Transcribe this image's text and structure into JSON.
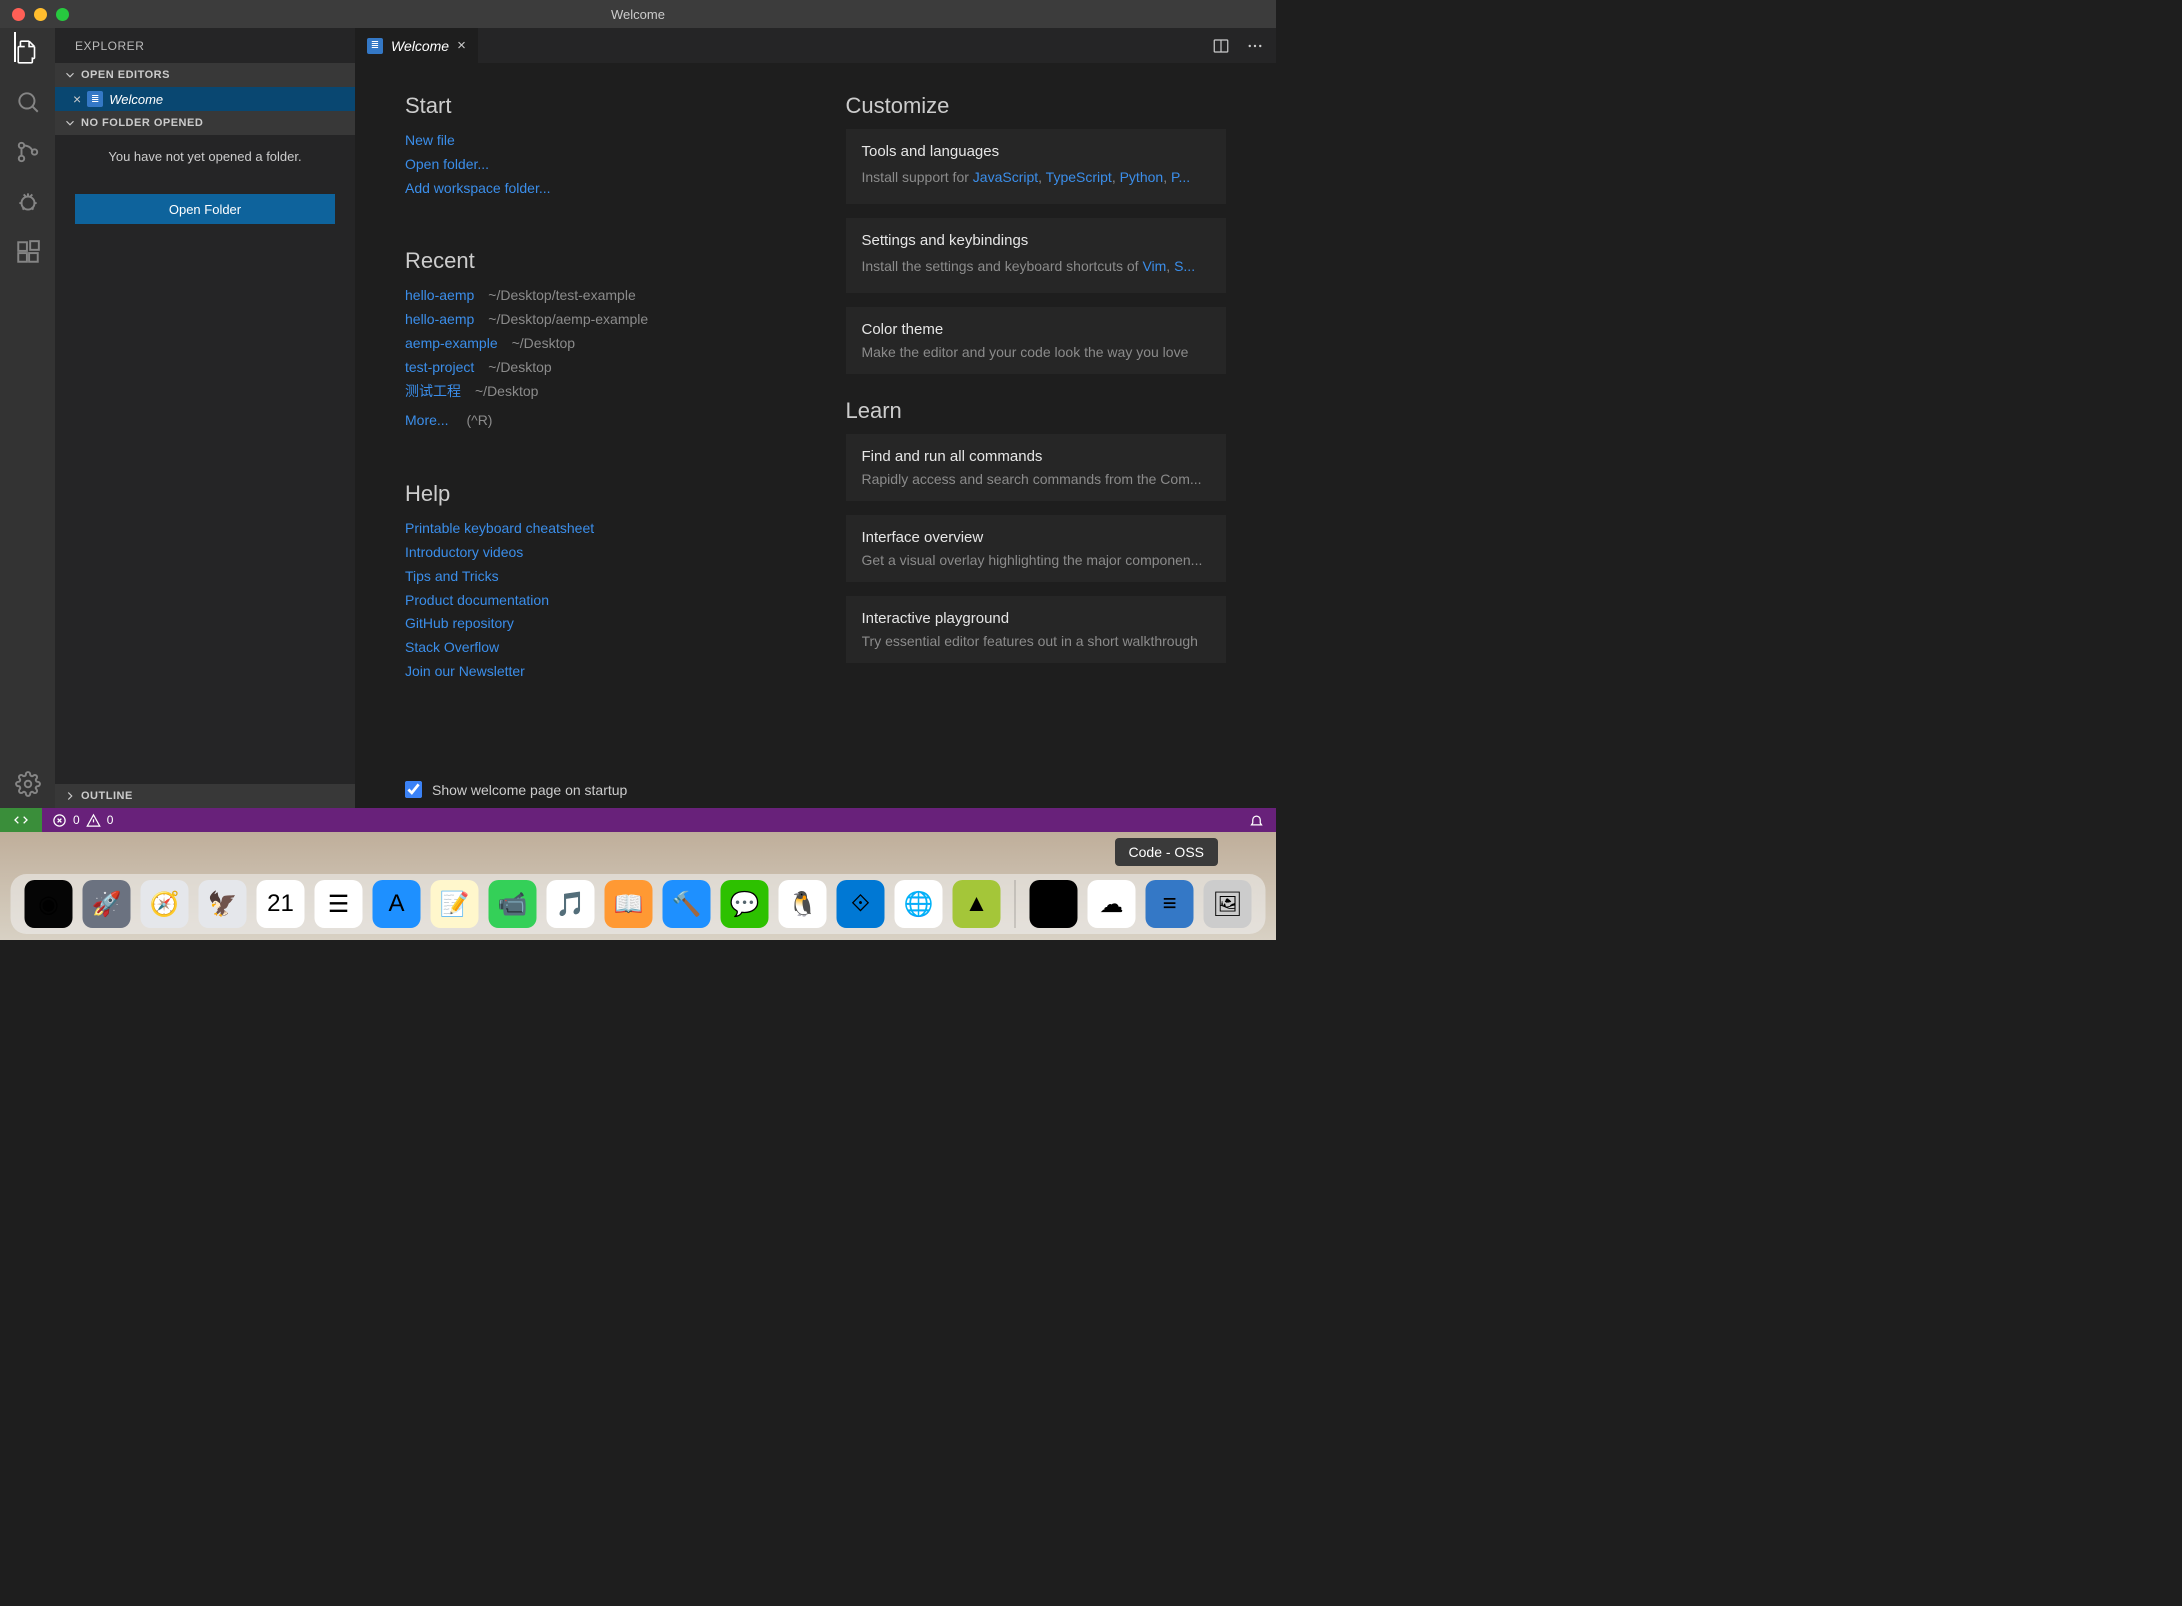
{
  "window": {
    "title": "Welcome"
  },
  "activityBar": {
    "items": [
      "files",
      "search",
      "source-control",
      "debug",
      "extensions"
    ],
    "bottom": [
      "settings"
    ]
  },
  "sidebar": {
    "title": "EXPLORER",
    "sections": {
      "openEditors": "OPEN EDITORS",
      "noFolder": "NO FOLDER OPENED",
      "outline": "OUTLINE"
    },
    "openEditorItem": "Welcome",
    "noFolderMsg": "You have not yet opened a folder.",
    "openFolderBtn": "Open Folder"
  },
  "tab": {
    "label": "Welcome"
  },
  "start": {
    "heading": "Start",
    "links": [
      "New file",
      "Open folder...",
      "Add workspace folder..."
    ]
  },
  "recent": {
    "heading": "Recent",
    "items": [
      {
        "name": "hello-aemp",
        "path": "~/Desktop/test-example"
      },
      {
        "name": "hello-aemp",
        "path": "~/Desktop/aemp-example"
      },
      {
        "name": "aemp-example",
        "path": "~/Desktop"
      },
      {
        "name": "test-project",
        "path": "~/Desktop"
      },
      {
        "name": "测试工程",
        "path": "~/Desktop"
      }
    ],
    "more": "More...",
    "moreHint": "(^R)"
  },
  "help": {
    "heading": "Help",
    "links": [
      "Printable keyboard cheatsheet",
      "Introductory videos",
      "Tips and Tricks",
      "Product documentation",
      "GitHub repository",
      "Stack Overflow",
      "Join our Newsletter"
    ]
  },
  "customize": {
    "heading": "Customize",
    "cards": [
      {
        "title": "Tools and languages",
        "subPrefix": "Install support for ",
        "links": [
          "JavaScript",
          "TypeScript",
          "Python",
          "P..."
        ]
      },
      {
        "title": "Settings and keybindings",
        "subPrefix": "Install the settings and keyboard shortcuts of ",
        "links": [
          "Vim",
          "S..."
        ]
      },
      {
        "title": "Color theme",
        "sub": "Make the editor and your code look the way you love"
      }
    ]
  },
  "learn": {
    "heading": "Learn",
    "cards": [
      {
        "title": "Find and run all commands",
        "sub": "Rapidly access and search commands from the Com..."
      },
      {
        "title": "Interface overview",
        "sub": "Get a visual overlay highlighting the major componen..."
      },
      {
        "title": "Interactive playground",
        "sub": "Try essential editor features out in a short walkthrough"
      }
    ]
  },
  "startupCheck": "Show welcome page on startup",
  "statusbar": {
    "errors": "0",
    "warnings": "0"
  },
  "tooltip": "Code - OSS",
  "dock": {
    "items": [
      {
        "name": "siri",
        "bg": "#050505",
        "glyph": "◉"
      },
      {
        "name": "launchpad",
        "bg": "#6b7280",
        "glyph": "🚀"
      },
      {
        "name": "safari",
        "bg": "#e5e7eb",
        "glyph": "🧭"
      },
      {
        "name": "mail",
        "bg": "#e5e7eb",
        "glyph": "🦅"
      },
      {
        "name": "calendar",
        "bg": "#ffffff",
        "glyph": "21"
      },
      {
        "name": "reminders",
        "bg": "#ffffff",
        "glyph": "☰"
      },
      {
        "name": "appstore",
        "bg": "#1e90ff",
        "glyph": "A"
      },
      {
        "name": "notes",
        "bg": "#fff7cc",
        "glyph": "📝"
      },
      {
        "name": "facetime",
        "bg": "#34d058",
        "glyph": "📹"
      },
      {
        "name": "music",
        "bg": "#ffffff",
        "glyph": "🎵"
      },
      {
        "name": "ibooks",
        "bg": "#ff9933",
        "glyph": "📖"
      },
      {
        "name": "xcode",
        "bg": "#1e90ff",
        "glyph": "🔨"
      },
      {
        "name": "wechat",
        "bg": "#2dc100",
        "glyph": "💬"
      },
      {
        "name": "qq",
        "bg": "#ffffff",
        "glyph": "🐧"
      },
      {
        "name": "vscode",
        "bg": "#0078d4",
        "glyph": "⟐"
      },
      {
        "name": "chrome",
        "bg": "#ffffff",
        "glyph": "🌐"
      },
      {
        "name": "android-studio",
        "bg": "#a4c639",
        "glyph": "▲"
      }
    ],
    "itemsRight": [
      {
        "name": "terminal",
        "bg": "#000000",
        "glyph": ">_"
      },
      {
        "name": "baidu",
        "bg": "#ffffff",
        "glyph": "☁"
      },
      {
        "name": "code-oss",
        "bg": "#3478c6",
        "glyph": "≡"
      },
      {
        "name": "preview",
        "bg": "#cccccc",
        "glyph": "🖼"
      }
    ]
  }
}
